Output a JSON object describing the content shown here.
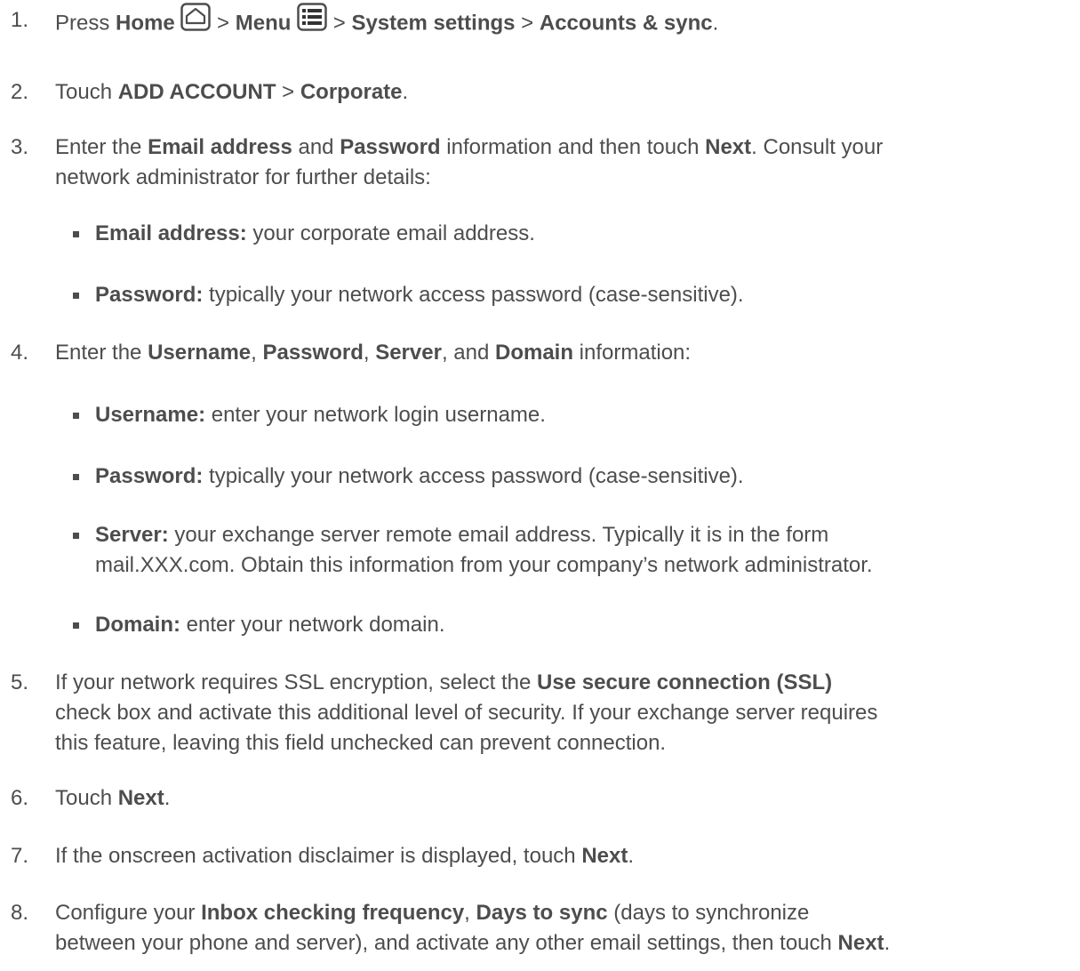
{
  "steps": [
    {
      "num": "1.",
      "a": "Press ",
      "home": "Home",
      "b": " > ",
      "menu": "Menu",
      "c": " > ",
      "d": "System settings",
      "e": " > ",
      "f": "Accounts & sync",
      "g": "."
    },
    {
      "num": "2.",
      "a": "Touch ",
      "b": "ADD ACCOUNT",
      "c": " > ",
      "d": "Corporate",
      "e": "."
    },
    {
      "num": "3.",
      "a": "Enter the ",
      "b": "Email address",
      "c": " and ",
      "d": "Password",
      "e": " information and then touch ",
      "f": "Next",
      "g": ". Consult your",
      "line2": "network administrator for further details:",
      "subs": [
        {
          "label": "Email address:",
          "text": " your corporate email address."
        },
        {
          "label": "Password:",
          "text": " typically your network access password (case-sensitive)."
        }
      ]
    },
    {
      "num": "4.",
      "a": "Enter the ",
      "b": "Username",
      "c": ", ",
      "d": "Password",
      "e": ", ",
      "f": "Server",
      "g": ", and ",
      "h": "Domain",
      "i": " information:",
      "subs": [
        {
          "label": "Username:",
          "text": " enter your network login username."
        },
        {
          "label": "Password:",
          "text": " typically your network access password (case-sensitive)."
        },
        {
          "label": "Server:",
          "text": " your exchange server remote email address. Typically it is in the form",
          "line2": "mail.XXX.com. Obtain this information from your company’s network administrator."
        },
        {
          "label": "Domain:",
          "text": " enter your network domain."
        }
      ]
    },
    {
      "num": "5.",
      "a": "If your network requires SSL encryption, select the ",
      "b": "Use secure connection (SSL)",
      "line2": "check box and activate this additional level of security. If your exchange server requires",
      "line3": "this feature, leaving this field unchecked can prevent connection."
    },
    {
      "num": "6.",
      "a": "Touch ",
      "b": "Next",
      "c": "."
    },
    {
      "num": "7.",
      "a": "If the onscreen activation disclaimer is displayed, touch ",
      "b": "Next",
      "c": "."
    },
    {
      "num": "8.",
      "a": "Configure your ",
      "b": "Inbox checking frequency",
      "c": ", ",
      "d": "Days to sync",
      "e": " (days to synchronize",
      "line2a": "between your phone and server), and activate any other email settings, then touch ",
      "line2b": "Next",
      "line2c": "."
    }
  ],
  "icons": {
    "home": "home-icon",
    "menu": "menu-icon"
  },
  "colors": {
    "text": "#4d4d4d"
  }
}
